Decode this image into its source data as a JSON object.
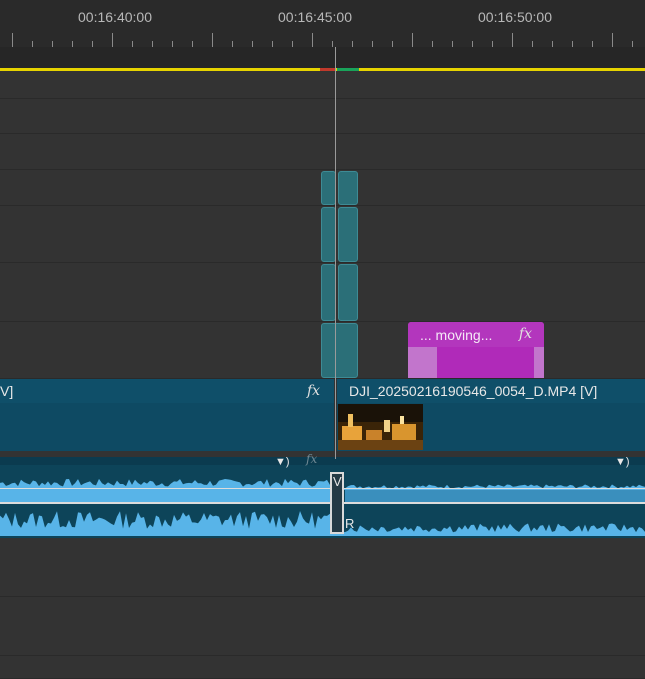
{
  "ruler": {
    "labels": [
      "00:16:40:00",
      "00:16:45:00",
      "00:16:50:00"
    ]
  },
  "colors": {
    "background": "#333333",
    "work_area": "#e6d300",
    "render_red": "#c0392b",
    "render_green": "#19a35a",
    "transition_clip": "#2b6f78",
    "video_clip": "#0e4a63",
    "title_clip": "#b02ab9",
    "audio_wave": "#58b4e8"
  },
  "title_clip": {
    "label": "... moving...",
    "fx": "fx"
  },
  "video_clips": {
    "left": {
      "label": "V]",
      "fx": "fx"
    },
    "right": {
      "label": "DJI_20250216190546_0054_D.MP4 [V]"
    }
  },
  "audio": {
    "left_fx": "fx",
    "keyframe_icon_left": "speaker-keyframe-icon",
    "keyframe_icon_right": "speaker-keyframe-icon",
    "cut_label_top": "V",
    "cut_label_bottom": "R"
  }
}
